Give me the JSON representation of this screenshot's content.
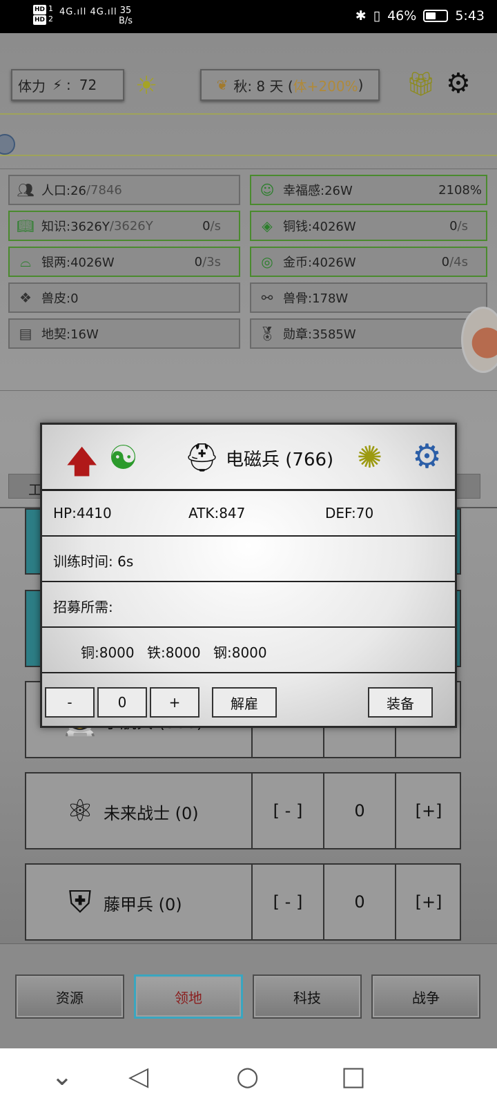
{
  "status_bar": {
    "hd1": "HD",
    "sim1": "1",
    "hd2": "HD",
    "sim2": "2",
    "signal": "4G.ıll 4G.ıll",
    "speed_value": "35",
    "speed_unit": "B/s",
    "bluetooth_icon": "✱",
    "vibrate_icon": "▯",
    "battery": "46%",
    "time": "5:43"
  },
  "header": {
    "stamina_label": "体力",
    "stamina_sep": ":",
    "stamina_value": "72",
    "season_label": "秋: 8 天 (",
    "season_bonus": "体+200%",
    "season_close": ")"
  },
  "resources": {
    "population": {
      "label": "人口:26",
      "max": "/7846"
    },
    "happiness": {
      "label": "幸福感:26W",
      "pct": "2108%"
    },
    "knowledge": {
      "label": "知识:3626Y",
      "max": "/3626Y",
      "rate": "0",
      "rate_unit": "/s"
    },
    "copper_coin": {
      "label": "铜钱:4026W",
      "rate": "0",
      "rate_unit": "/s"
    },
    "silver": {
      "label": "银两:4026W",
      "rate": "0",
      "rate_unit": "/3s"
    },
    "gold": {
      "label": "金币:4026W",
      "rate": "0",
      "rate_unit": "/4s"
    },
    "hide": {
      "label": "兽皮:0"
    },
    "bone": {
      "label": "兽骨:178W"
    },
    "deed": {
      "label": "地契:16W"
    },
    "medal": {
      "label": "勋章:3585W"
    }
  },
  "list": {
    "tab_label": "工",
    "rows": [
      {
        "name": "宇航兵 (300)",
        "minus": "[ - ]",
        "count": "0",
        "plus": "[+]"
      },
      {
        "name": "未来战士 (0)",
        "minus": "[ - ]",
        "count": "0",
        "plus": "[+]"
      },
      {
        "name": "藤甲兵 (0)",
        "minus": "[ - ]",
        "count": "0",
        "plus": "[+]"
      }
    ]
  },
  "modal": {
    "title": "电磁兵 (766)",
    "hp": "HP:4410",
    "atk": "ATK:847",
    "def": "DEF:70",
    "train_time": "训练时间:  6s",
    "recruit_need": "招募所需:",
    "cost_copper": "铜:8000",
    "cost_iron": "铁:8000",
    "cost_steel": "钢:8000",
    "minus": "-",
    "qty": "0",
    "plus": "+",
    "dismiss": "解雇",
    "equip": "装备"
  },
  "nav": {
    "resources": "资源",
    "territory": "领地",
    "tech": "科技",
    "war": "战争"
  },
  "colors": {
    "accent_teal": "#2d7e86",
    "active_tab_border": "#3aa6c0",
    "green_border": "#4a8a2e",
    "red_arrow": "#b01919"
  }
}
